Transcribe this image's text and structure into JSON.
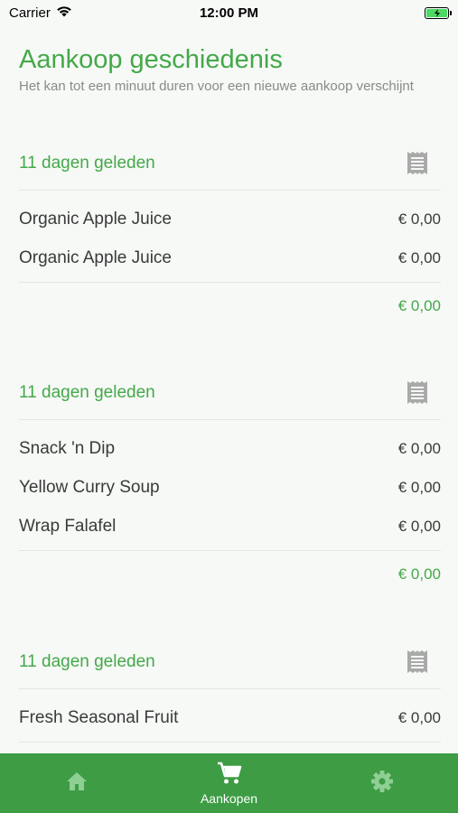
{
  "status_bar": {
    "carrier": "Carrier",
    "time": "12:00 PM"
  },
  "header": {
    "title": "Aankoop geschiedenis",
    "subtitle": "Het kan tot een minuut duren voor een nieuwe aankoop verschijnt"
  },
  "purchases": [
    {
      "date": "11 dagen geleden",
      "items": [
        {
          "name": "Organic Apple Juice",
          "price": "€ 0,00"
        },
        {
          "name": "Organic Apple Juice",
          "price": "€ 0,00"
        }
      ],
      "total": "€ 0,00"
    },
    {
      "date": "11 dagen geleden",
      "items": [
        {
          "name": "Snack 'n Dip",
          "price": "€ 0,00"
        },
        {
          "name": "Yellow Curry Soup",
          "price": "€ 0,00"
        },
        {
          "name": "Wrap Falafel",
          "price": "€ 0,00"
        }
      ],
      "total": "€ 0,00"
    },
    {
      "date": "11 dagen geleden",
      "items": [
        {
          "name": "Fresh Seasonal Fruit",
          "price": "€ 0,00"
        }
      ]
    }
  ],
  "tab_bar": {
    "tabs": [
      {
        "icon": "home-icon",
        "label": ""
      },
      {
        "icon": "cart-icon",
        "label": "Aankopen"
      },
      {
        "icon": "gear-icon",
        "label": ""
      }
    ]
  },
  "colors": {
    "accent": "#45a84a",
    "tab_bar": "#3d9c44",
    "background": "#f6f9f6"
  }
}
